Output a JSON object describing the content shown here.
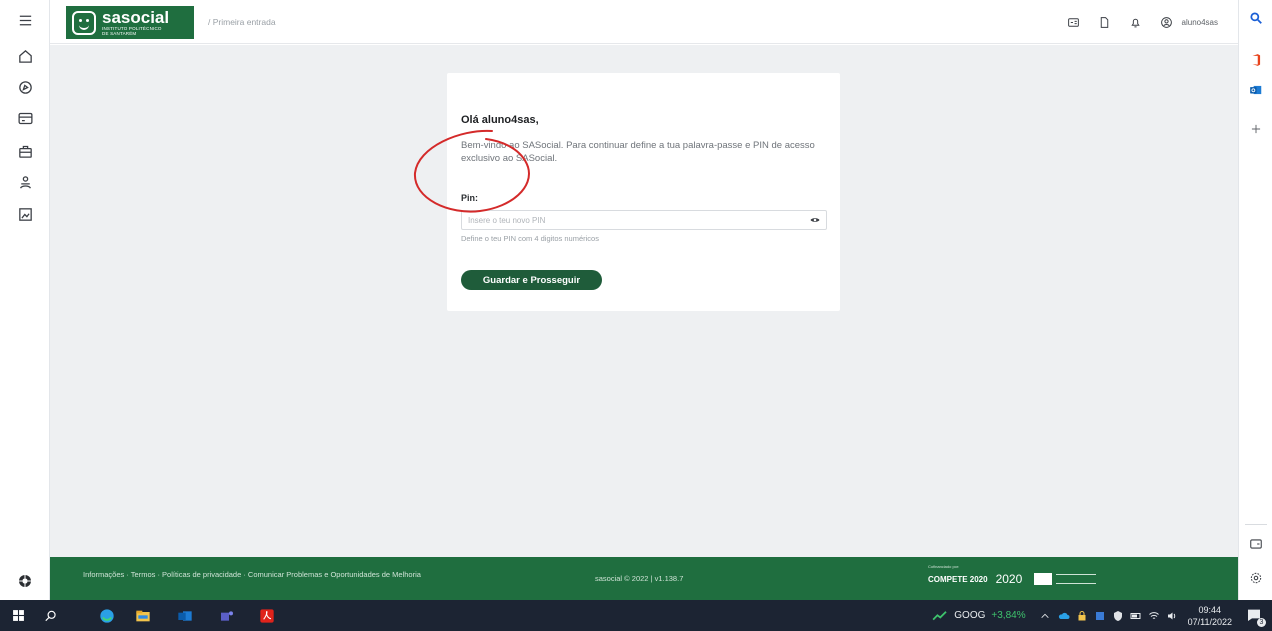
{
  "header": {
    "brand": "sasocial",
    "institution_line1": "INSTITUTO POLITÉCNICO",
    "institution_line2": "DE SANTARÉM",
    "breadcrumb": "/  Primeira entrada",
    "username": "aluno4sas"
  },
  "card": {
    "greeting": "Olá aluno4sas,",
    "intro": "Bem-vindo ao SASocial. Para continuar define a tua palavra-passe e PIN de acesso exclusivo ao SASocial.",
    "pin_label": "Pin:",
    "pin_placeholder": "Insere o teu novo PIN",
    "pin_value": "",
    "pin_hint": "Define o teu PIN com 4 digitos numéricos",
    "submit_label": "Guardar e Prosseguir"
  },
  "footer": {
    "links": "Informações · Termos · Políticas de privacidade · Comunicar Problemas e Oportunidades de Melhoria",
    "copyright": "sasocial © 2022 | v1.138.7",
    "funding_small": "Cofinanciado por:",
    "compete": "COMPETE 2020",
    "portugal2020": "2020"
  },
  "taskbar": {
    "stock_symbol": "GOOG",
    "stock_change": "+3,84%",
    "time": "09:44",
    "date": "07/11/2022",
    "notifications": "3"
  },
  "colors": {
    "brand_green": "#1f6e3f",
    "button_green": "#1f5c3a",
    "content_bg": "#eef0f2",
    "annotation_red": "#d42a2a"
  }
}
